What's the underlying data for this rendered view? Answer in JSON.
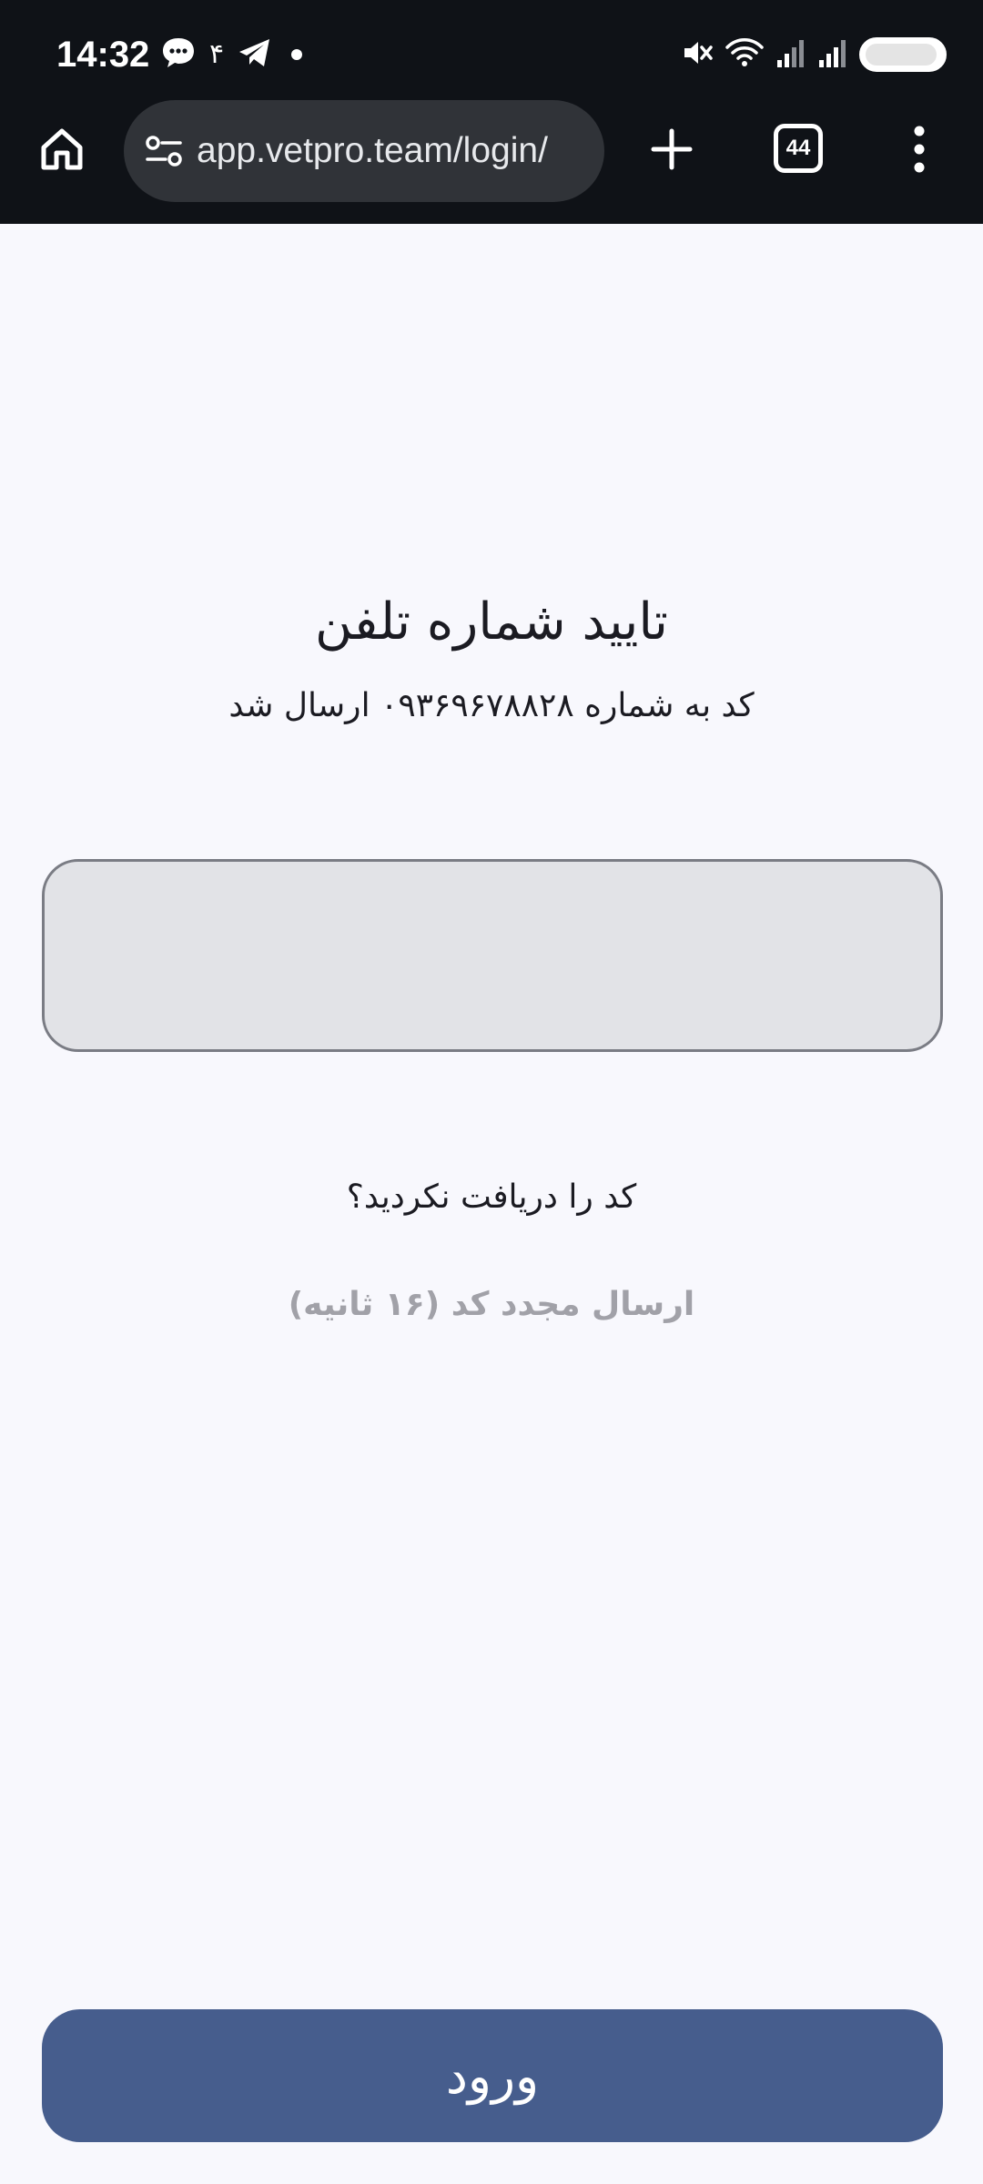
{
  "status_bar": {
    "time": "14:32",
    "notification_count": "۴",
    "icons_left": [
      "chat-icon",
      "telegram-icon",
      "dot-icon"
    ],
    "icons_right": [
      "mute-icon",
      "wifi-icon",
      "signal-icon",
      "signal-icon",
      "battery-icon"
    ]
  },
  "browser": {
    "url": "app.vetpro.team/login/",
    "tab_count": "44",
    "icons": [
      "home-icon",
      "tune-icon",
      "plus-icon",
      "tabs-icon",
      "more-vert-icon"
    ]
  },
  "page": {
    "title": "تایید شماره تلفن",
    "subtitle": "کد به شماره ۰۹۳۶۹۶۷۸۸۲۸ ارسال شد",
    "code_input": {
      "value": "",
      "placeholder": ""
    },
    "not_received": "کد را دریافت نکردید؟",
    "resend": "ارسال مجدد کد (۱۶ ثانیه)",
    "login_button": "ورود"
  },
  "colors": {
    "chrome_background": "#0f1217",
    "page_background": "#f8f8fd",
    "input_background": "#e2e3e7",
    "primary_button": "#465d8d",
    "muted_text": "#a1a1a8"
  }
}
